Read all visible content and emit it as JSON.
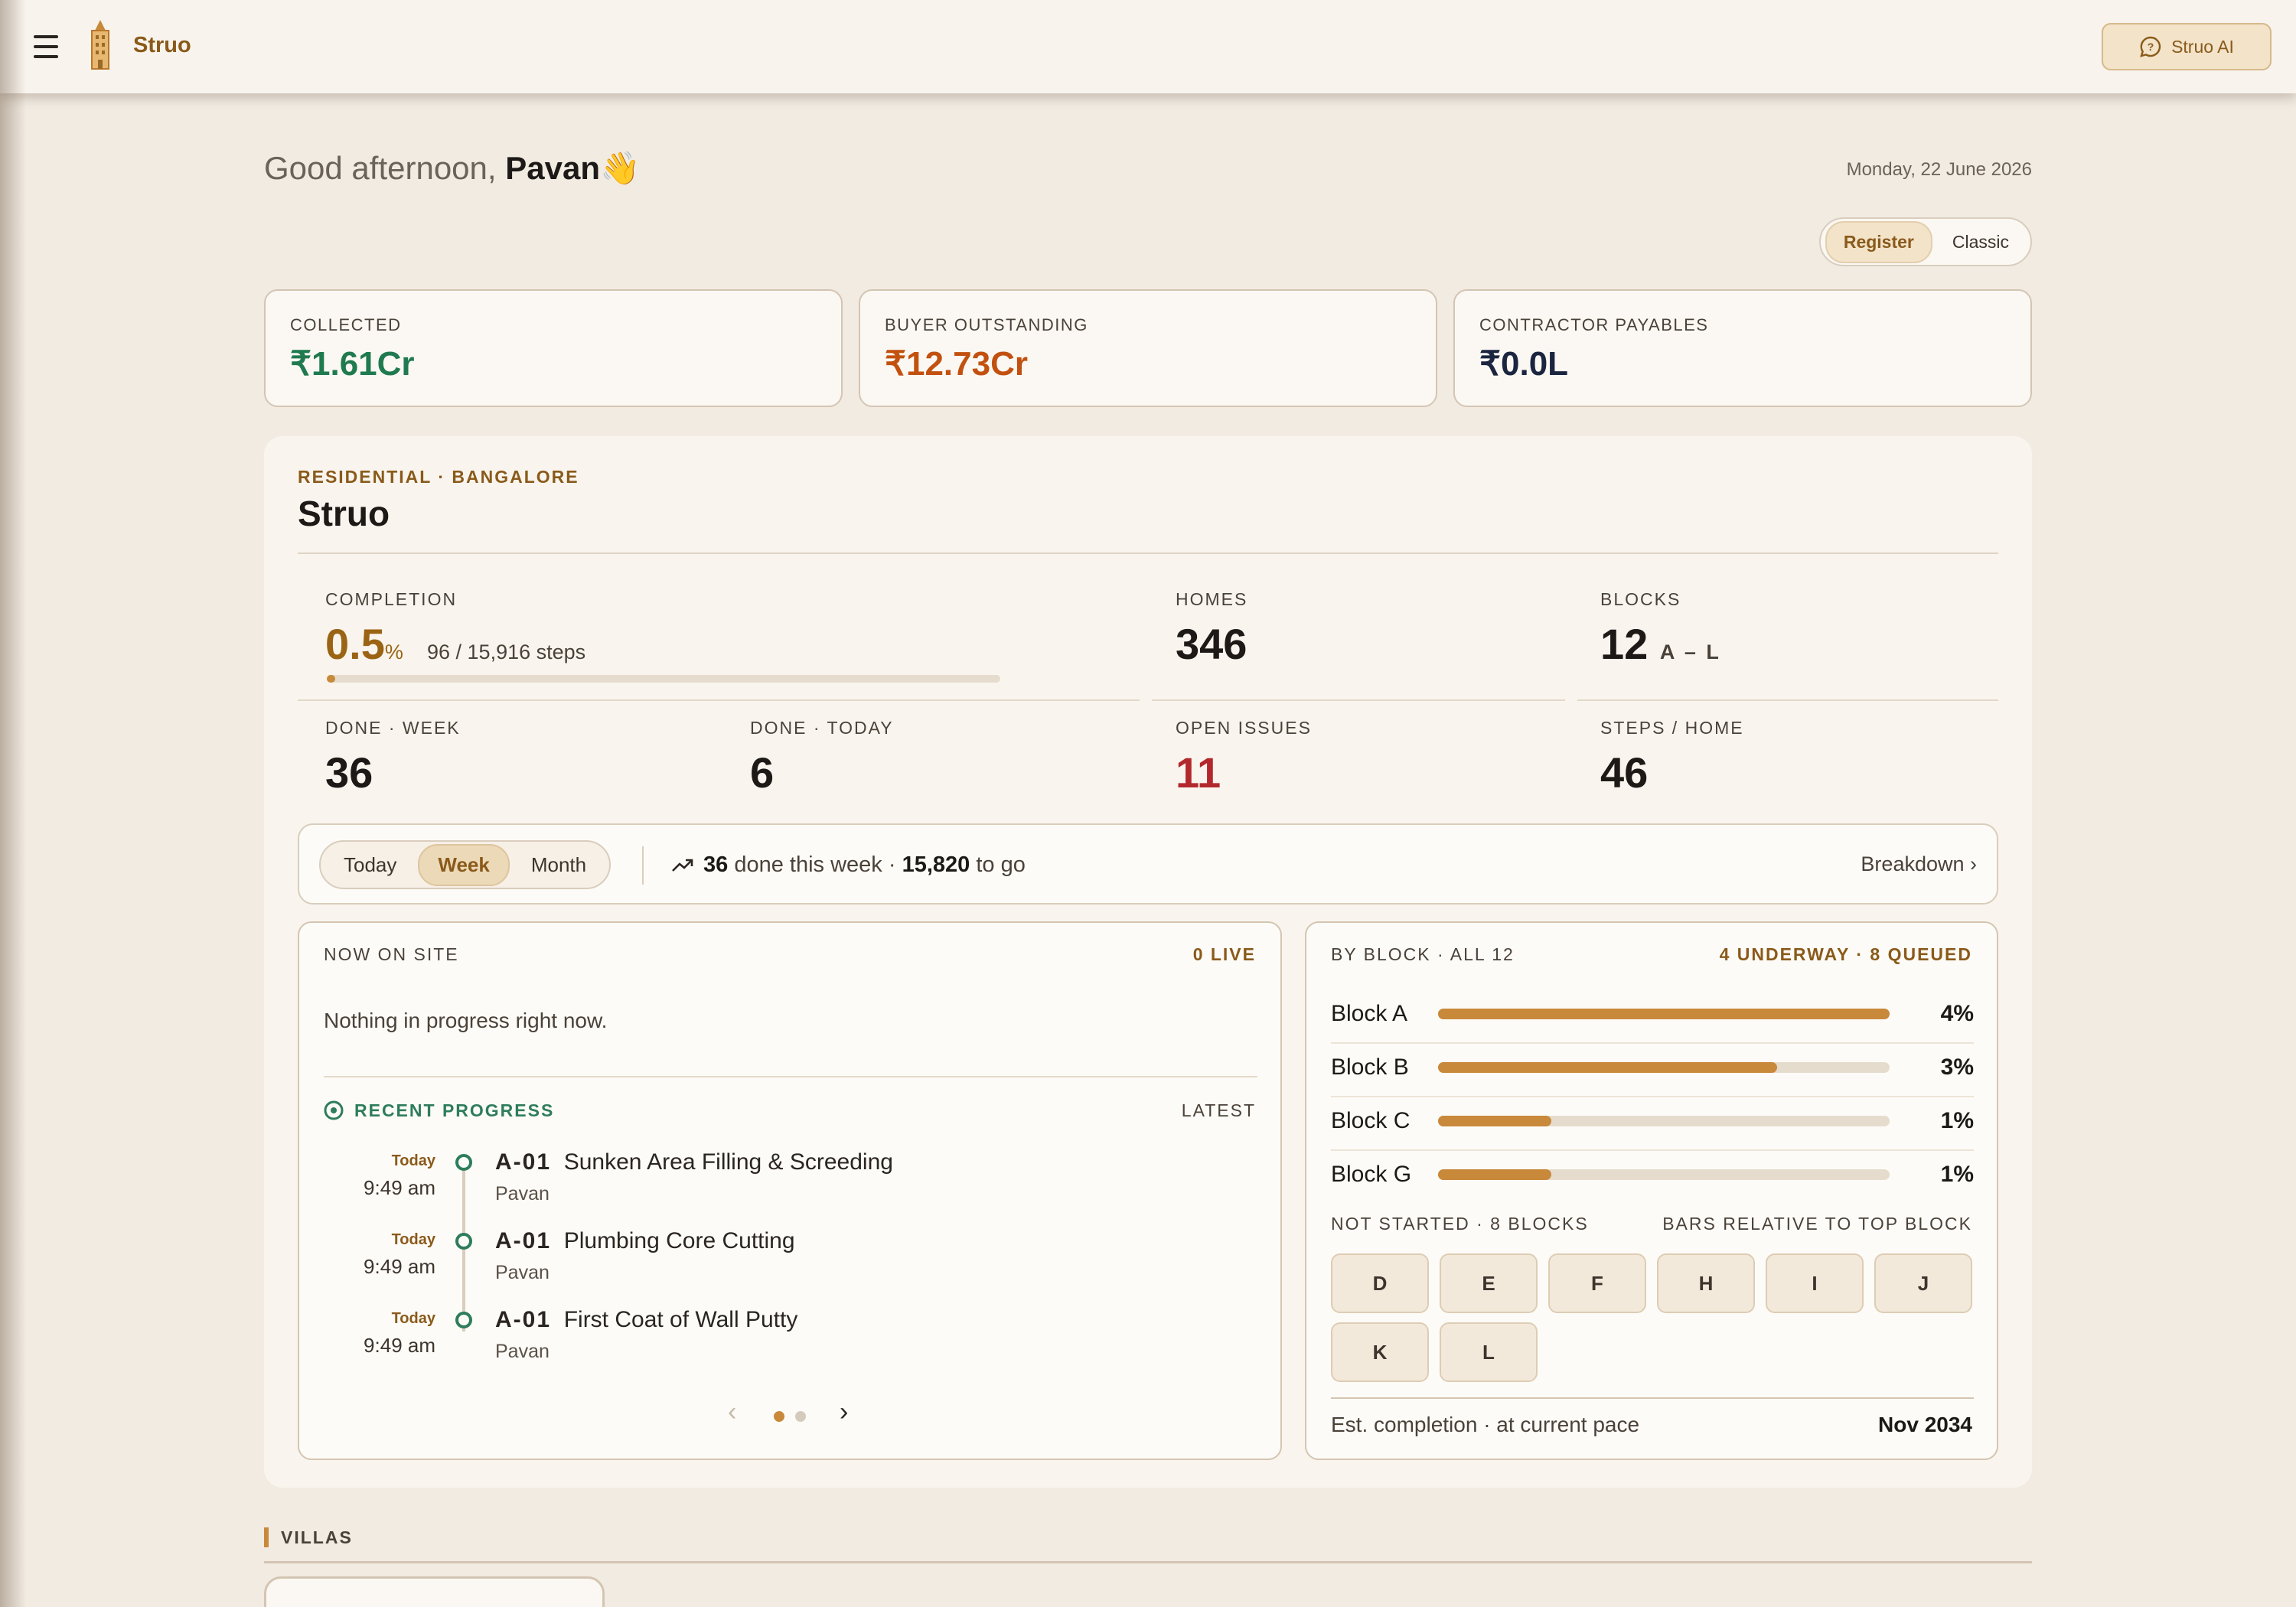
{
  "app": {
    "brand": "Struo",
    "ai_button": "Struo AI"
  },
  "greeting": {
    "prefix": "Good afternoon,",
    "name": "Pavan",
    "emoji": "👋"
  },
  "date": "Monday, 22 June 2026",
  "view_toggle": {
    "options": [
      "Register",
      "Classic"
    ],
    "selected": "Register"
  },
  "kpis": [
    {
      "label": "COLLECTED",
      "value": "₹1.61Cr",
      "color": "#1f7a4f"
    },
    {
      "label": "BUYER OUTSTANDING",
      "value": "₹12.73Cr",
      "color": "#c2510f"
    },
    {
      "label": "CONTRACTOR PAYABLES",
      "value": "₹0.0L",
      "color": "#1b2540"
    }
  ],
  "project": {
    "eyebrow": "RESIDENTIAL · BANGALORE",
    "name": "Struo",
    "completion": {
      "label": "COMPLETION",
      "value": "0.5",
      "unit": "%",
      "steps": "96 / 15,916 steps",
      "fraction": 0.005
    },
    "homes": {
      "label": "HOMES",
      "value": "346"
    },
    "blocks": {
      "label": "BLOCKS",
      "value": "12",
      "range": "A – L"
    },
    "done_week": {
      "label": "DONE · WEEK",
      "value": "36"
    },
    "done_today": {
      "label": "DONE · TODAY",
      "value": "6"
    },
    "open_issues": {
      "label": "OPEN ISSUES",
      "value": "11",
      "color": "#b3282d"
    },
    "steps_home": {
      "label": "STEPS / HOME",
      "value": "46"
    }
  },
  "period_tabs": {
    "options": [
      "Today",
      "Week",
      "Month"
    ],
    "selected": "Week"
  },
  "summary": {
    "done": "36",
    "done_text": "done this week ·",
    "to_go": "15,820",
    "to_go_text": "to go"
  },
  "breakdown_link": "Breakdown ›",
  "now_on_site": {
    "label": "NOW ON SITE",
    "live": "0 LIVE",
    "empty": "Nothing in progress right now.",
    "recent_label": "RECENT PROGRESS",
    "latest_label": "LATEST",
    "items": [
      {
        "day": "Today",
        "time": "9:49 am",
        "unit": "A-01",
        "task": "Sunken Area Filling & Screeding",
        "by": "Pavan"
      },
      {
        "day": "Today",
        "time": "9:49 am",
        "unit": "A-01",
        "task": "Plumbing Core Cutting",
        "by": "Pavan"
      },
      {
        "day": "Today",
        "time": "9:49 am",
        "unit": "A-01",
        "task": "First Coat of Wall Putty",
        "by": "Pavan"
      }
    ],
    "pager": {
      "prev": "‹",
      "next": "›",
      "pages": 2,
      "current": 1
    }
  },
  "by_block": {
    "label": "BY BLOCK · ALL 12",
    "status": "4 UNDERWAY · 8 QUEUED",
    "rows": [
      {
        "name": "Block A",
        "pct": "4%",
        "relative": 1.0
      },
      {
        "name": "Block B",
        "pct": "3%",
        "relative": 0.75
      },
      {
        "name": "Block C",
        "pct": "1%",
        "relative": 0.25
      },
      {
        "name": "Block G",
        "pct": "1%",
        "relative": 0.25
      }
    ],
    "not_started_label": "NOT STARTED · 8 BLOCKS",
    "bars_note": "BARS RELATIVE TO TOP BLOCK",
    "not_started": [
      "D",
      "E",
      "F",
      "H",
      "I",
      "J",
      "K",
      "L"
    ],
    "est_label": "Est. completion · at current pace",
    "est_value": "Nov 2034"
  },
  "villas": {
    "label": "VILLAS"
  }
}
